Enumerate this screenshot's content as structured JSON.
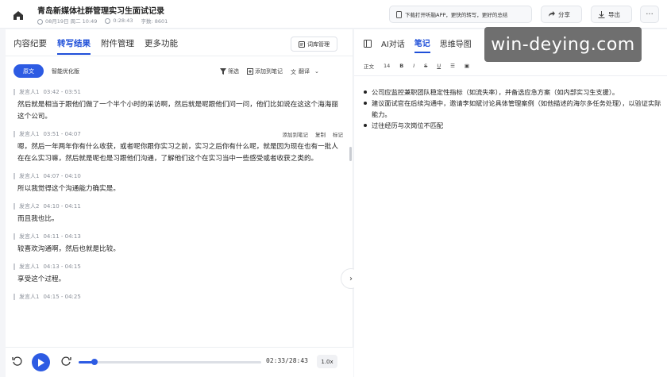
{
  "header": {
    "title": "青岛新媒体社群管理实习生面试记录",
    "date": "08月19日 周二 10:49",
    "duration": "0:28:43",
    "word_count": "字数: 8601",
    "promo_label": "下载打开听脑APP，更快的转写，更好的总结",
    "share_label": "分享",
    "export_label": "导出",
    "more_label": "···"
  },
  "left": {
    "tabs": [
      "内容纪要",
      "转写结果",
      "附件管理",
      "更多功能"
    ],
    "active_tab": 1,
    "vocab_label": "词库管理",
    "seg_original": "原文",
    "seg_smart": "智能优化版",
    "tools": {
      "filter": "筛选",
      "add_note": "添加到笔记",
      "translate": "翻译"
    },
    "row_actions": {
      "add_note": "添加到笔记",
      "copy": "复制",
      "mark": "标记"
    },
    "entries": [
      {
        "speaker": "发言人1",
        "time": "03:42 - 03:51",
        "text": "然后就是相当于跟他们做了一个半个小时的采访啊，然后就是呢跟他们问一问，他们比如说在这这个海海丽这个公司。"
      },
      {
        "speaker": "发言人1",
        "time": "03:51 - 04:07",
        "text": "嗯，然后一年两年你有什么收获，或者呢你跟你实习之前，实习之后你有什么呢，就是因为现在也有一批人在在么实习嘛，然后就是呢也是习跟他们沟通，了解他们这个在实习当中一些感受或者收获之类的。"
      },
      {
        "speaker": "发言人1",
        "time": "04:07 - 04:10",
        "text": "所以我觉得这个沟通能力确实是。"
      },
      {
        "speaker": "发言人2",
        "time": "04:10 - 04:11",
        "text": "而且我也比。"
      },
      {
        "speaker": "发言人1",
        "time": "04:11 - 04:13",
        "text": "较喜欢沟通啊，然后也就是比较。"
      },
      {
        "speaker": "发言人1",
        "time": "04:13 - 04:15",
        "text": "享受这个过程。"
      },
      {
        "speaker": "发言人1",
        "time": "04:15 - 04:25",
        "text": ""
      }
    ]
  },
  "player": {
    "time": "02:33/28:43",
    "speed": "1.0x",
    "progress": 0.089
  },
  "right": {
    "tabs": [
      "AI对话",
      "笔记",
      "思维导图"
    ],
    "active_tab": 1,
    "format": {
      "style": "正文",
      "size": "14",
      "bold": "B",
      "italic": "I",
      "strike": "S",
      "underline": "U"
    },
    "notes": [
      "公司应监控兼职团队稳定性指标（如流失率），并备选应急方案（如内部实习生支援）。",
      "建议面试官在后续沟通中，邀请李如斌讨论具体管理案例（如他描述的海尔多任务处理），以验证实际能力。",
      "过往经历与次岗位不匹配"
    ]
  },
  "watermark": "win-deying.com",
  "colors": {
    "accent": "#2d5be3",
    "tab_active": "#1f4fd8"
  }
}
